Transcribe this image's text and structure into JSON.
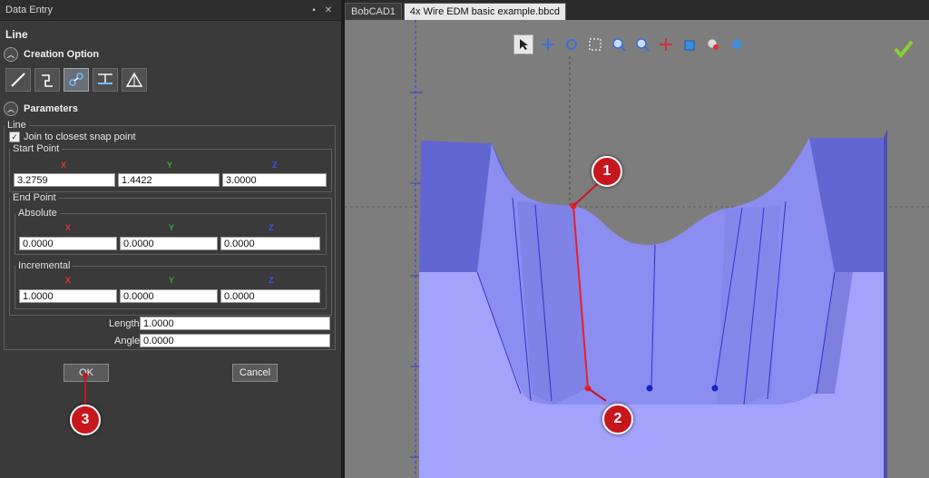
{
  "panel": {
    "title": "Data Entry",
    "pin_glyph": "▪",
    "close_glyph": "✕",
    "heading": "Line",
    "creation_option_label": "Creation Option",
    "creation_tools": [
      "line-tool-icon",
      "polyline-tool-icon",
      "snap-tool-icon",
      "horizontal-tool-icon",
      "angle-tool-icon"
    ],
    "parameters_label": "Parameters",
    "line_group_label": "Line",
    "join_snap_label": "Join to closest snap point",
    "join_snap_checked": true,
    "start_point": {
      "label": "Start Point",
      "axes": [
        "X",
        "Y",
        "Z"
      ],
      "values": [
        "3.2759",
        "1.4422",
        "3.0000"
      ]
    },
    "end_point": {
      "label": "End Point",
      "absolute": {
        "label": "Absolute",
        "axes": [
          "X",
          "Y",
          "Z"
        ],
        "values": [
          "0.0000",
          "0.0000",
          "0.0000"
        ]
      },
      "incremental": {
        "label": "Incremental",
        "axes": [
          "X",
          "Y",
          "Z"
        ],
        "values": [
          "1.0000",
          "0.0000",
          "0.0000"
        ]
      }
    },
    "length_label": "Length",
    "length_value": "1.0000",
    "angle_label": "Angle",
    "angle_value": "0.0000",
    "ok_label": "OK",
    "cancel_label": "Cancel"
  },
  "tabs": [
    {
      "label": "BobCAD1",
      "active": false
    },
    {
      "label": "4x Wire EDM basic example.bbcd",
      "active": true
    }
  ],
  "viewport": {
    "toolbar_icons": [
      "select-pointer-icon",
      "pan-icon",
      "rotate-icon",
      "box-select-icon",
      "zoom-icon",
      "zoom-fit-icon",
      "axis-icon",
      "cube-view-icon",
      "visibility-icon",
      "snap-settings-icon"
    ],
    "confirm_icon": "checkmark-icon",
    "callouts": [
      "1",
      "2",
      "3"
    ]
  },
  "colors": {
    "callout": "#c8161d",
    "part_face": "#8f8ff0",
    "part_top": "#5f63c8",
    "accent_check": "#8ad132"
  }
}
